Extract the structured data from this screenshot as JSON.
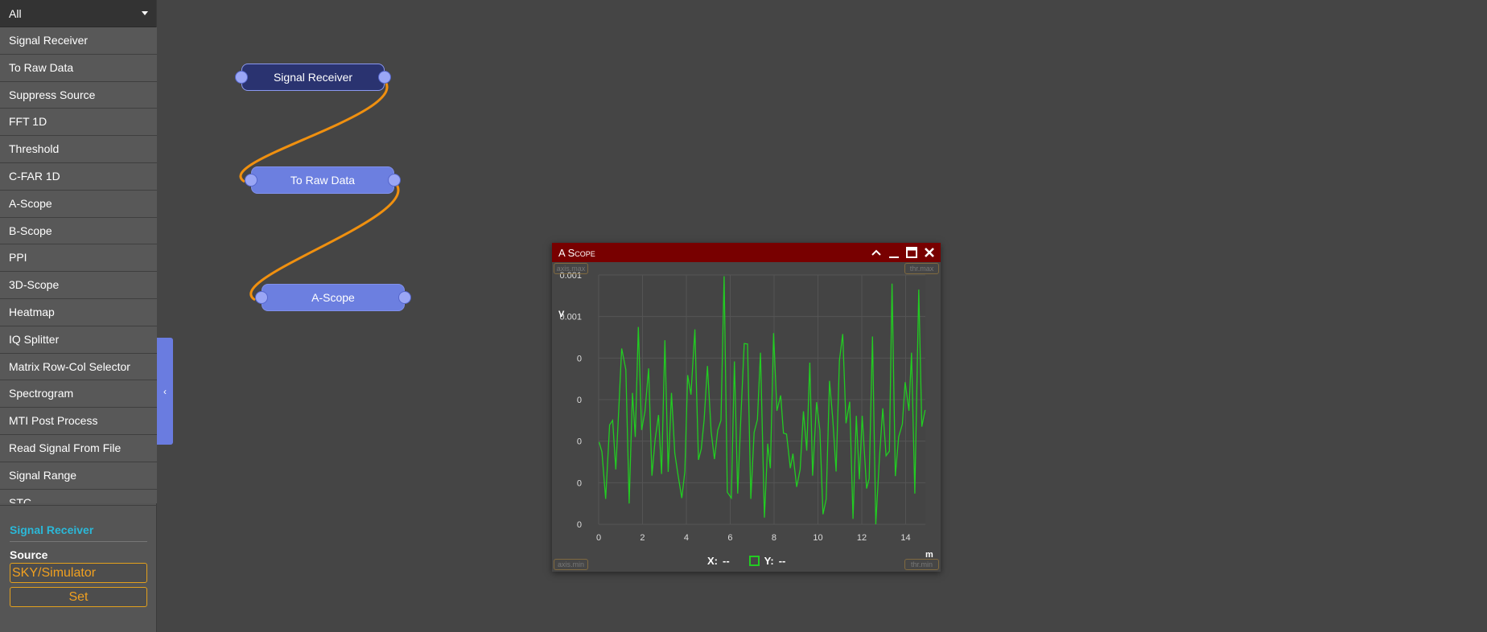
{
  "sidebar": {
    "filter": "All",
    "items": [
      "Signal Receiver",
      "To Raw Data",
      "Suppress Source",
      "FFT 1D",
      "Threshold",
      "C-FAR 1D",
      "A-Scope",
      "B-Scope",
      "PPI",
      "3D-Scope",
      "Heatmap",
      "IQ Splitter",
      "Matrix Row-Col Selector",
      "Spectrogram",
      "MTI Post Process",
      "Read Signal From File",
      "Signal Range",
      "STC"
    ],
    "props": {
      "title": "Signal Receiver",
      "source_label": "Source",
      "source_value": "SKY/Simulator",
      "set_label": "Set"
    },
    "collapse_icon": "‹"
  },
  "nodes": [
    {
      "label": "Signal Receiver",
      "selected": true
    },
    {
      "label": "To Raw Data"
    },
    {
      "label": "A-Scope"
    }
  ],
  "colors": {
    "wire": "#f0900f",
    "trace": "#22cc22",
    "titlebar": "#780000",
    "node": "#6c7fe0"
  },
  "scope": {
    "title": "A Scope",
    "corners": {
      "axis_max": "axis.max",
      "thr_max": "thr.max",
      "axis_min": "axis.min",
      "thr_min": "thr.min"
    },
    "legend": {
      "x_label": "X:",
      "x_value": "--",
      "y_label": "Y:",
      "y_value": "--"
    }
  },
  "chart_data": {
    "type": "line",
    "xlabel": "m",
    "ylabel": "V",
    "xlim": [
      0,
      14.9
    ],
    "ylim": [
      0,
      0.0006
    ],
    "xticks": [
      0,
      2,
      4,
      6,
      8,
      10,
      12,
      14
    ],
    "yticks": [
      0,
      0.0001,
      0.0002,
      0.0003,
      0.0004,
      0.0005,
      0.0006
    ],
    "ytick_labels": [
      "0",
      "0",
      "0",
      "0",
      "0",
      "0.001",
      "0.001"
    ],
    "grid": true,
    "x": [
      0.02,
      0.15,
      0.32,
      0.5,
      0.64,
      0.78,
      0.92,
      1.05,
      1.24,
      1.39,
      1.54,
      1.67,
      1.81,
      1.96,
      2.11,
      2.28,
      2.43,
      2.58,
      2.73,
      2.87,
      3.02,
      3.17,
      3.32,
      3.47,
      3.62,
      3.79,
      3.93,
      4.06,
      4.21,
      4.39,
      4.55,
      4.68,
      4.81,
      4.96,
      5.13,
      5.28,
      5.43,
      5.58,
      5.72,
      5.87,
      6.05,
      6.19,
      6.34,
      6.49,
      6.64,
      6.79,
      6.94,
      7.09,
      7.24,
      7.38,
      7.56,
      7.71,
      7.83,
      7.98,
      8.13,
      8.3,
      8.43,
      8.57,
      8.74,
      8.86,
      9.03,
      9.19,
      9.34,
      9.49,
      9.63,
      9.76,
      9.94,
      10.09,
      10.23,
      10.38,
      10.53,
      10.68,
      10.83,
      10.98,
      11.13,
      11.28,
      11.45,
      11.6,
      11.75,
      11.89,
      12.02,
      12.22,
      12.34,
      12.49,
      12.64,
      12.81,
      12.96,
      13.11,
      13.26,
      13.38,
      13.53,
      13.68,
      13.85,
      13.98,
      14.15,
      14.27,
      14.42,
      14.6,
      14.74,
      14.89
    ],
    "y": [
      0.000198,
      0.000174,
      6.1e-05,
      0.000239,
      0.00025,
      0.000132,
      0.000281,
      0.000423,
      0.000372,
      5e-05,
      0.000316,
      0.00021,
      0.000475,
      0.000227,
      0.000271,
      0.000375,
      0.000117,
      0.000206,
      0.000263,
      0.000121,
      0.000443,
      0.000126,
      0.000316,
      0.000171,
      0.000119,
      6.3e-05,
      0.000127,
      0.000359,
      0.000312,
      0.000469,
      0.000155,
      0.000181,
      0.000252,
      0.000381,
      0.000223,
      0.000157,
      0.000226,
      0.00025,
      0.000597,
      7.7e-05,
      6.3e-05,
      0.000392,
      7.4e-05,
      0.000261,
      0.000435,
      0.000434,
      6.1e-05,
      0.000221,
      0.000252,
      0.000413,
      1.6e-05,
      0.000194,
      0.000135,
      0.00046,
      0.000273,
      0.00031,
      0.000219,
      0.000217,
      0.000135,
      0.00017,
      9e-05,
      0.000132,
      0.000272,
      0.000177,
      0.000389,
      0.000117,
      0.000294,
      0.000226,
      2.4e-05,
      6.1e-05,
      0.000345,
      0.000252,
      0.000127,
      0.000394,
      0.000458,
      0.000243,
      0.000295,
      1.3e-05,
      0.000261,
      0.000108,
      0.000261,
      8.6e-05,
      0.00011,
      0.000452,
      0.0,
      0.000165,
      0.000279,
      0.000165,
      0.000176,
      0.000579,
      0.000116,
      0.00021,
      0.000241,
      0.000342,
      0.000273,
      0.000413,
      7.4e-05,
      0.000565,
      0.000235,
      0.000275
    ]
  }
}
